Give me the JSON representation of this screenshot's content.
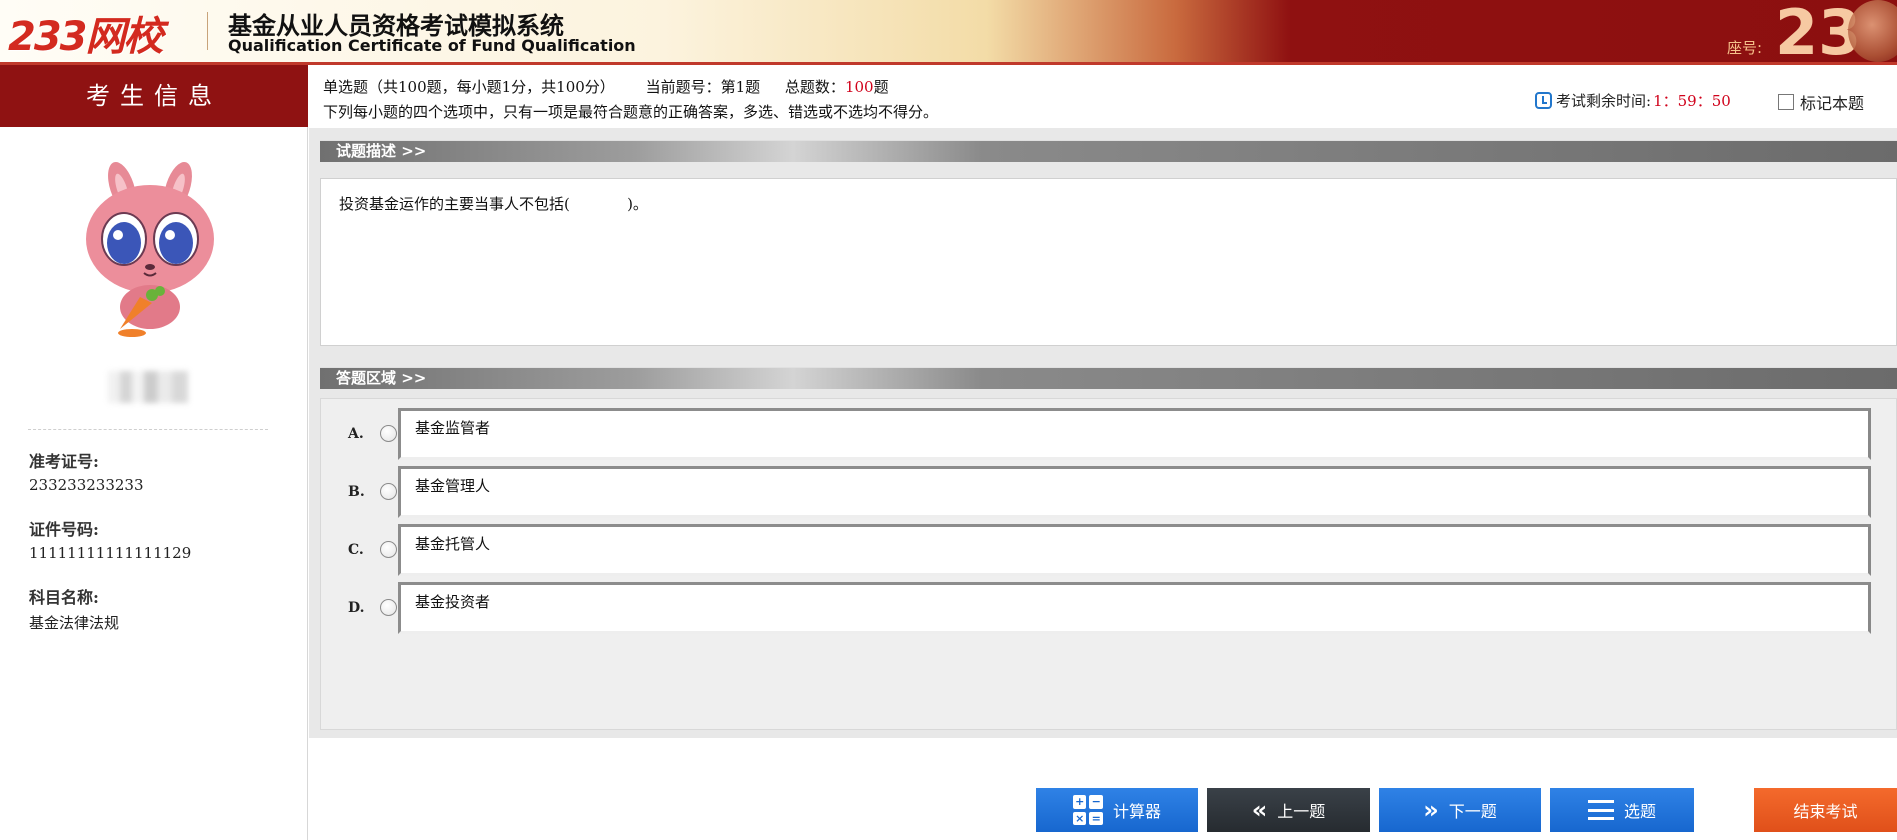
{
  "header": {
    "logo": "233网校",
    "system_title": "基金从业人员资格考试模拟系统",
    "system_subtitle": "Qualification Certificate of Fund Qualification",
    "seat_label": "座号:",
    "seat_number": "23"
  },
  "sidebar": {
    "heading": "考生信息",
    "exam_id_label": "准考证号:",
    "exam_id_value": "233233233233",
    "cert_label": "证件号码:",
    "cert_value": "11111111111111129",
    "subject_label": "科目名称:",
    "subject_value": "基金法律法规"
  },
  "question_info": {
    "type_text": "单选题（共100题，每小题1分，共100分）",
    "current_label": "当前题号：第1题",
    "total_label": "总题数：",
    "total_value": "100",
    "total_unit": "题",
    "instruction": "下列每小题的四个选项中，只有一项是最符合题意的正确答案，多选、错选或不选均不得分。"
  },
  "timer": {
    "label": "考试剩余时间:",
    "value": "1：59：50"
  },
  "mark_label": "标记本题",
  "sections": {
    "description_title": "试题描述 >>",
    "answer_title": "答题区域 >>"
  },
  "question_text": "投资基金运作的主要当事人不包括(            )。",
  "options": [
    {
      "letter": "A.",
      "text": "基金监管者"
    },
    {
      "letter": "B.",
      "text": "基金管理人"
    },
    {
      "letter": "C.",
      "text": "基金托管人"
    },
    {
      "letter": "D.",
      "text": "基金投资者"
    }
  ],
  "buttons": {
    "calculator": "计算器",
    "prev": "上一题",
    "next": "下一题",
    "select": "选题",
    "end": "结束考试"
  },
  "colors": {
    "brand_red": "#8f1212",
    "accent_red": "#d0021b",
    "button_blue": "#1767cf",
    "button_dark": "#2c3238",
    "button_orange": "#e9561f"
  }
}
